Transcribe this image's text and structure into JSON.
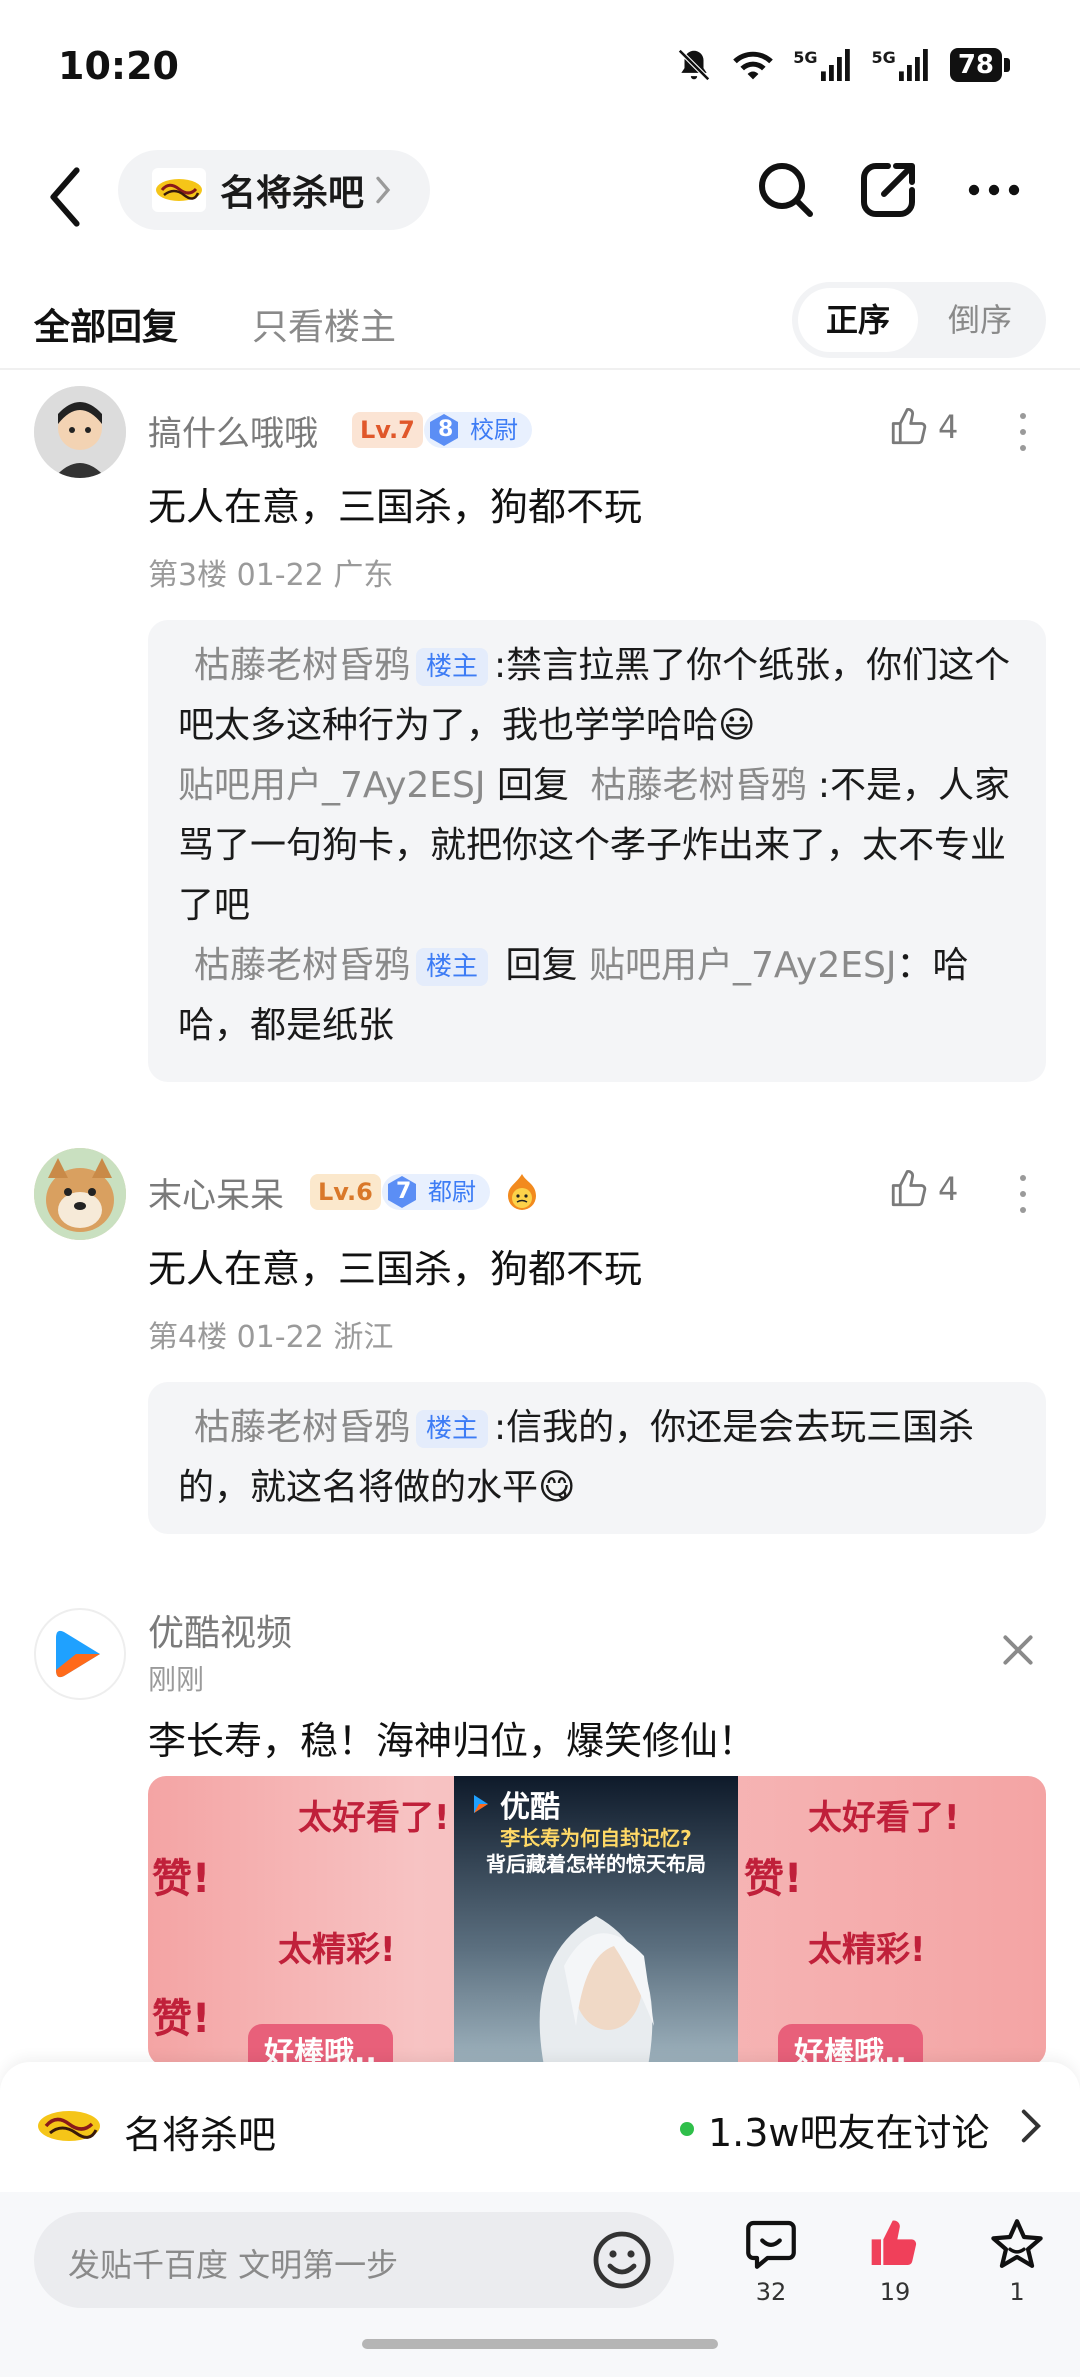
{
  "status": {
    "time": "10:20",
    "net1": "5G",
    "net2": "5G",
    "battery": "78"
  },
  "nav": {
    "forum_name": "名将杀吧"
  },
  "tabs": {
    "all": "全部回复",
    "owner_only": "只看楼主",
    "order_asc": "正序",
    "order_desc": "倒序"
  },
  "posts": [
    {
      "username": "搞什么哦哦",
      "level": "Lv.7",
      "rank_num": "8",
      "rank_title": "校尉",
      "likes": "4",
      "content": "无人在意，三国杀，狗都不玩",
      "meta": "第3楼  01-22  广东",
      "replies": [
        {
          "name": "枯藤老树昏鸦",
          "badge": "楼主",
          "text": ":禁言拉黑了你个纸张，你们这个吧太多这种行为了，我也学学哈哈😃"
        },
        {
          "name": "贴吧用户_7Ay2ESJ",
          "reply_word": "回复",
          "target": "枯藤老树昏鸦",
          "text": ":不是，人家骂了一句狗卡，就把你这个孝子炸出来了，太不专业了吧"
        },
        {
          "name": "枯藤老树昏鸦",
          "badge": "楼主",
          "reply_word": "回复",
          "target": "贴吧用户_7Ay2ESJ",
          "text": "：哈哈，都是纸张"
        }
      ]
    },
    {
      "username": "末心呆呆",
      "level": "Lv.6",
      "rank_num": "7",
      "rank_title": "都尉",
      "likes": "4",
      "content": "无人在意，三国杀，狗都不玩",
      "meta": "第4楼  01-22  浙江",
      "replies": [
        {
          "name": "枯藤老树昏鸦",
          "badge": "楼主",
          "text": ":信我的，你还是会去玩三国杀的，就这名将做的水平😋"
        }
      ]
    }
  ],
  "ad": {
    "source": "优酷视频",
    "time": "刚刚",
    "text": "李长寿，稳！海神归位，爆笑修仙！",
    "image_brand": "优酷",
    "image_caption1": "李长寿为何自封记忆?",
    "image_caption2": "背后藏着怎样的惊天布局",
    "sticker_good": "太好看了!",
    "sticker_like": "赞!",
    "sticker_wonderful": "太精彩!",
    "sticker_great": "好棒哦.."
  },
  "forum_bar": {
    "name": "名将杀吧",
    "online": "1.3w吧友在讨论"
  },
  "bottom_bar": {
    "placeholder": "发贴千百度 文明第一步",
    "comments": "32",
    "likes": "19",
    "favorites": "1"
  },
  "colors": {
    "accent_blue": "#3d7cf5",
    "like_red": "#f0405a",
    "online_green": "#2fbf4a"
  }
}
